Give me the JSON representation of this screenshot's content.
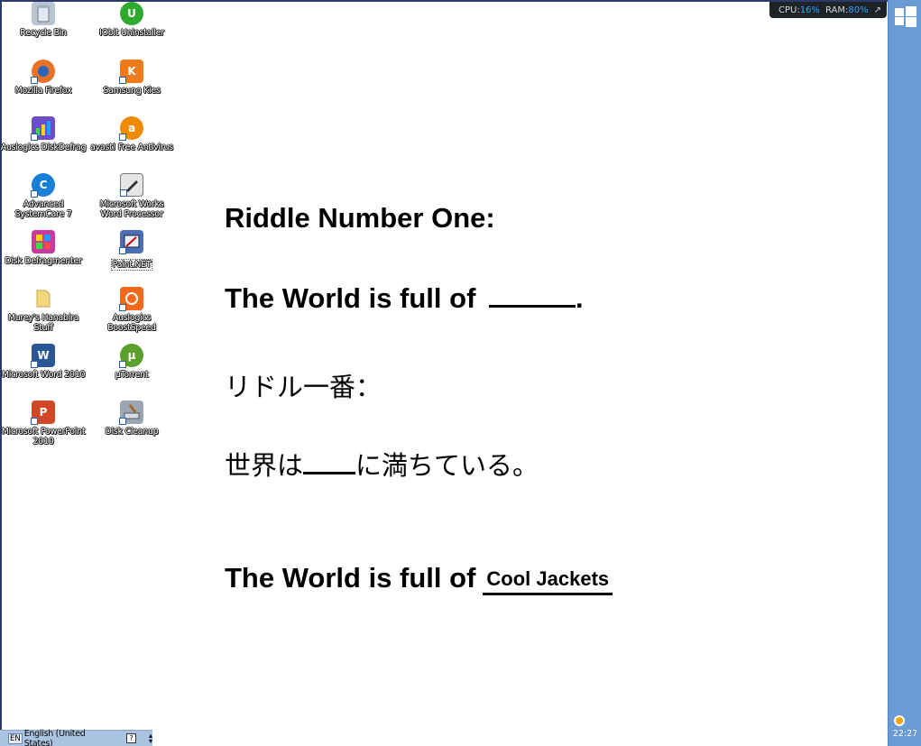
{
  "desktop_icons": [
    {
      "label": "Recycle Bin",
      "icon": "recycle-bin-icon",
      "color": "#b8c4d0"
    },
    {
      "label": "IObit Uninstaller",
      "icon": "iobit-uninstaller-icon",
      "color": "#2faa2f"
    },
    {
      "label": "Mozilla Firefox",
      "icon": "firefox-icon",
      "color": "#e8712a"
    },
    {
      "label": "Samsung Kies",
      "icon": "samsung-kies-icon",
      "color": "#f07a1a"
    },
    {
      "label": "Auslogics DiskDefrag",
      "icon": "disk-defrag-icon",
      "color": "#6a4fc9"
    },
    {
      "label": "avast! Free Antivirus",
      "icon": "avast-icon",
      "color": "#f08a00"
    },
    {
      "label": "Advanced SystemCare 7",
      "icon": "systemcare-icon",
      "color": "#1a7fd6"
    },
    {
      "label": "Microsoft Works Word Processor",
      "icon": "works-word-icon",
      "color": "#e6e6e6"
    },
    {
      "label": "Disk Defragmenter",
      "icon": "disk-defragmenter-icon",
      "color": "#c83aa0"
    },
    {
      "label": "Paint.NET",
      "icon": "paint-net-icon",
      "color": "#4a6fb5"
    },
    {
      "label": "Murey's Hanabira Stuff",
      "icon": "folder-icon",
      "color": "#f2d77c"
    },
    {
      "label": "Auslogics BoostSpeed",
      "icon": "boostspeed-icon",
      "color": "#f26a1b"
    },
    {
      "label": "Microsoft Word 2010",
      "icon": "word-2010-icon",
      "color": "#2b5797"
    },
    {
      "label": "µTorrent",
      "icon": "utorrent-icon",
      "color": "#5aa02c"
    },
    {
      "label": "Microsoft PowerPoint 2010",
      "icon": "powerpoint-2010-icon",
      "color": "#d24726"
    },
    {
      "label": "Disk Cleanup",
      "icon": "disk-cleanup-icon",
      "color": "#9aa6b2"
    }
  ],
  "riddle": {
    "title": "Riddle Number One:",
    "question_prefix": "The World is full of",
    "question_suffix": ".",
    "title_jp": "リドル一番：",
    "question_jp_prefix": "世界は",
    "question_jp_suffix": "に満ちている。",
    "answer_prefix": "The World is full of",
    "answer": "Cool Jackets"
  },
  "monitor": {
    "cpu_label": "CPU:",
    "cpu_value": "16%",
    "ram_label": "RAM:",
    "ram_value": "80%",
    "expand_icon": "arrow-up-right-icon"
  },
  "taskbar": {
    "clock": "22:27",
    "start_icon": "windows-logo-icon",
    "tray_icon": "avast-tray-icon"
  },
  "language_bar": {
    "code": "EN",
    "language": "English (United States)",
    "help": "?"
  },
  "colors": {
    "charm_bar": "#6a9bd4",
    "monitor_bg": "#1e2328",
    "monitor_value": "#29a9ff",
    "language_bar": "#a9c3e0"
  }
}
